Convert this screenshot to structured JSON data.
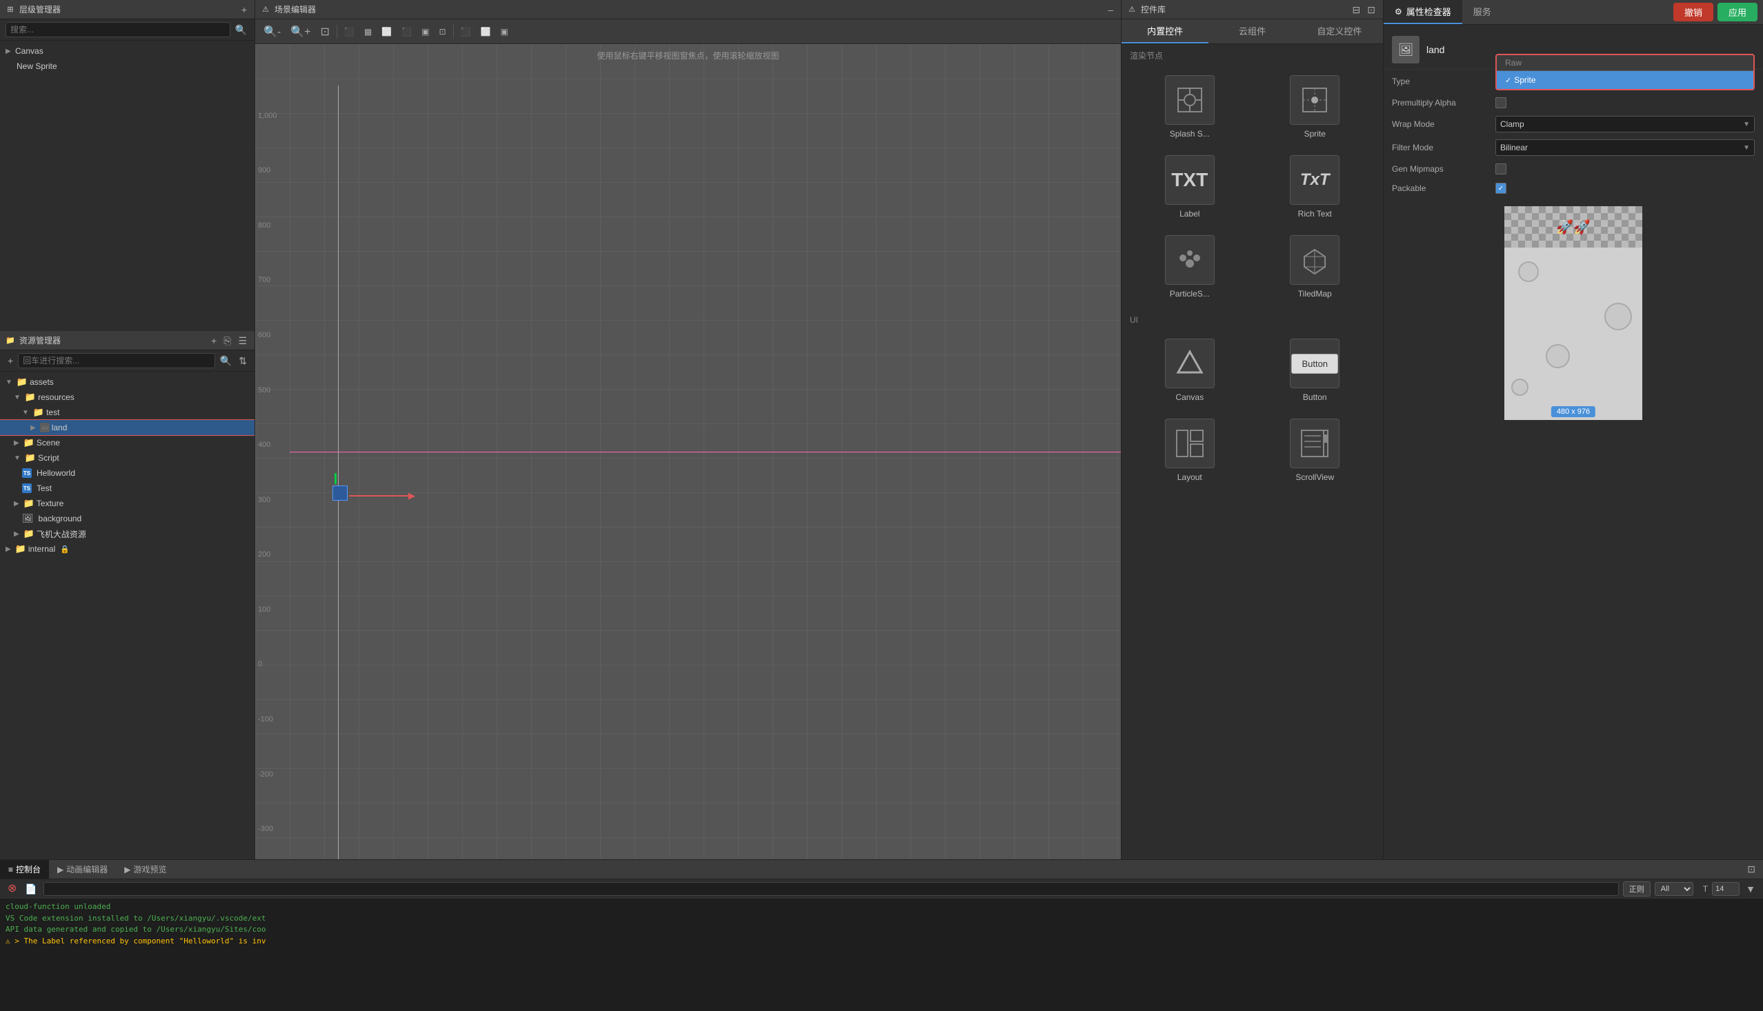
{
  "topbar": {
    "label": ""
  },
  "layerManager": {
    "title": "层级管理器",
    "icon": "⊞",
    "search_placeholder": "搜索...",
    "items": [
      {
        "label": "Canvas",
        "indent": 0,
        "type": "canvas"
      },
      {
        "label": "New Sprite",
        "indent": 1,
        "type": "sprite",
        "selected": false
      }
    ]
  },
  "assetManager": {
    "title": "资源管理器",
    "search_placeholder": "回车进行搜索...",
    "items": [
      {
        "label": "assets",
        "type": "folder",
        "indent": 0,
        "expanded": true
      },
      {
        "label": "resources",
        "type": "folder",
        "indent": 1,
        "expanded": true
      },
      {
        "label": "test",
        "type": "folder",
        "indent": 2,
        "expanded": true
      },
      {
        "label": "land",
        "type": "file",
        "indent": 3,
        "selected": true,
        "highlighted": true
      },
      {
        "label": "Scene",
        "type": "folder",
        "indent": 1,
        "expanded": false
      },
      {
        "label": "Script",
        "type": "folder",
        "indent": 1,
        "expanded": true
      },
      {
        "label": "Helloworld",
        "type": "ts",
        "indent": 2
      },
      {
        "label": "Test",
        "type": "ts",
        "indent": 2
      },
      {
        "label": "Texture",
        "type": "folder",
        "indent": 1,
        "expanded": false
      },
      {
        "label": "background",
        "type": "image",
        "indent": 2
      },
      {
        "label": "飞机大战资源",
        "type": "folder",
        "indent": 1,
        "expanded": false
      },
      {
        "label": "internal",
        "type": "folder-lock",
        "indent": 0,
        "expanded": false
      }
    ]
  },
  "sceneEditor": {
    "title": "场景编辑器",
    "hint": "使用鼠标右键平移视图窗焦点，使用滚轮缩放视图",
    "y_labels": [
      "900",
      "800",
      "700",
      "600",
      "500",
      "400",
      "300",
      "200",
      "100",
      "0",
      "-100",
      "-200",
      "-300"
    ],
    "top_label": "1,000"
  },
  "widgetLibrary": {
    "title": "控件库",
    "tabs": [
      {
        "label": "内置控件",
        "active": true
      },
      {
        "label": "云组件"
      },
      {
        "label": "自定义控件"
      }
    ],
    "render_section": "渲染节点",
    "ui_section": "UI",
    "widgets": [
      {
        "label": "Splash S...",
        "type": "splash"
      },
      {
        "label": "Sprite",
        "type": "sprite"
      },
      {
        "label": "Label",
        "type": "label"
      },
      {
        "label": "Rich Text",
        "type": "richtext"
      },
      {
        "label": "ParticleS...",
        "type": "particle"
      },
      {
        "label": "TiledMap",
        "type": "tiledmap"
      },
      {
        "label": "Canvas",
        "type": "canvas"
      },
      {
        "label": "Button",
        "type": "button"
      },
      {
        "label": "Layout",
        "type": "layout"
      },
      {
        "label": "ScrollView",
        "type": "scrollview"
      }
    ]
  },
  "properties": {
    "title": "属性检查器",
    "service_tab": "服务",
    "cancel_btn": "撤销",
    "apply_btn": "应用",
    "asset_name": "land",
    "dropdown_header": "Raw",
    "dropdown_items": [
      {
        "label": "Sprite",
        "selected": true
      }
    ],
    "fields": [
      {
        "label": "Type",
        "type": "dropdown-open",
        "value": "Sprite"
      },
      {
        "label": "Premultiply Alpha",
        "type": "checkbox",
        "checked": false
      },
      {
        "label": "Wrap Mode",
        "type": "select",
        "value": "Clamp"
      },
      {
        "label": "Filter Mode",
        "type": "select",
        "value": "Bilinear"
      },
      {
        "label": "Gen Mipmaps",
        "type": "checkbox",
        "checked": false
      },
      {
        "label": "Packable",
        "type": "checkbox",
        "checked": true
      }
    ],
    "image_size": "480 x 976"
  },
  "console": {
    "tabs": [
      {
        "label": "控制台",
        "icon": "≡",
        "active": true
      },
      {
        "label": "动画编辑器",
        "icon": "▶"
      },
      {
        "label": "游戏预览",
        "icon": "▶"
      }
    ],
    "filter_label": "正则",
    "filter_value": "All",
    "font_size": "14",
    "lines": [
      {
        "text": "cloud-function unloaded",
        "type": "info"
      },
      {
        "text": "VS Code extension installed to /Users/xiangyu/.vscode/ext",
        "type": "info"
      },
      {
        "text": "API data generated and copied to /Users/xiangyu/Sites/coo",
        "type": "info"
      },
      {
        "text": "⚠ > The Label referenced by component \"Helloworld\" is inv",
        "type": "warning"
      }
    ]
  }
}
